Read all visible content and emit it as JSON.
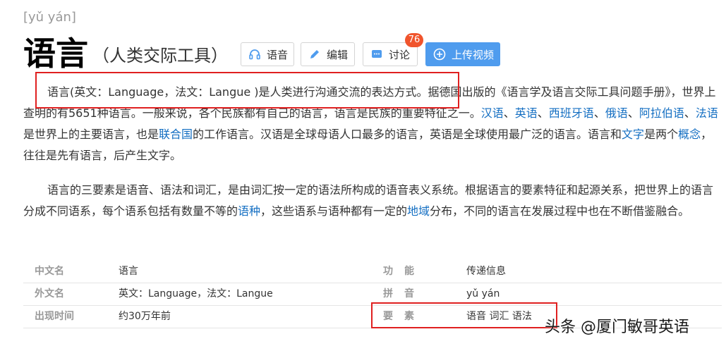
{
  "header": {
    "pinyin": "[yǔ yán]",
    "title": "语言",
    "subtitle": "（人类交际工具）"
  },
  "toolbar": {
    "voice_label": "语音",
    "edit_label": "编辑",
    "discuss_label": "讨论",
    "discuss_count": "76",
    "upload_label": "上传视频",
    "accent_color": "#4f9cee",
    "badge_color": "#f0542c"
  },
  "paragraph1": {
    "s1": "语言(英文：Language，法文：Langue )是人类进行沟通交流的表达方式。据德国出版的《语言学及语言交际工具问题手册》，世界上查明的有5651种语言。一般来说，各个民族都有自己的语言，语言是民族的重要特征之一。",
    "l1": "汉语",
    "sep1": "、",
    "l2": "英语",
    "sep2": "、",
    "l3": "西班牙语",
    "sep3": "、",
    "l4": "俄语",
    "sep4": "、",
    "l5": "阿拉伯语",
    "sep5": "、",
    "l6": "法语",
    "s2": "是世界上的主要语言，也是",
    "l7": "联合国",
    "s3": "的工作语言。汉语是全球母语人口最多的语言，英语是全球使用最广泛的语言。语言和",
    "l8": "文字",
    "s4": "是两个",
    "l9": "概念",
    "s5": "，往往是先有语言，后产生文字。"
  },
  "paragraph2": {
    "s1": "语言的三要素是语音、语法和词汇，是由词汇按一定的语法所构成的语音表义系统。根据语言的要素特征和起源关系，把世界上的语言分成不同语系，每个语系包括有数量不等的",
    "l1": "语种",
    "s2": "，这些语系与语种都有一定的",
    "l2": "地域",
    "s3": "分布，不同的语言在发展过程中也在不断借鉴融合。"
  },
  "info": [
    {
      "k1": "中文名",
      "v1": "语言",
      "k2": "功能",
      "v2": "传递信息"
    },
    {
      "k1": "外文名",
      "v1": "英文：Language，法文：Langue",
      "k2": "拼音",
      "v2": "yǔ yán"
    },
    {
      "k1": "出现时间",
      "v1": "约30万年前",
      "k2": "要素",
      "v2": "语音 词汇 语法"
    }
  ],
  "link_color": "#136ec2",
  "highlight_color": "#e02020",
  "watermark": "头条 @厦门敏哥英语"
}
